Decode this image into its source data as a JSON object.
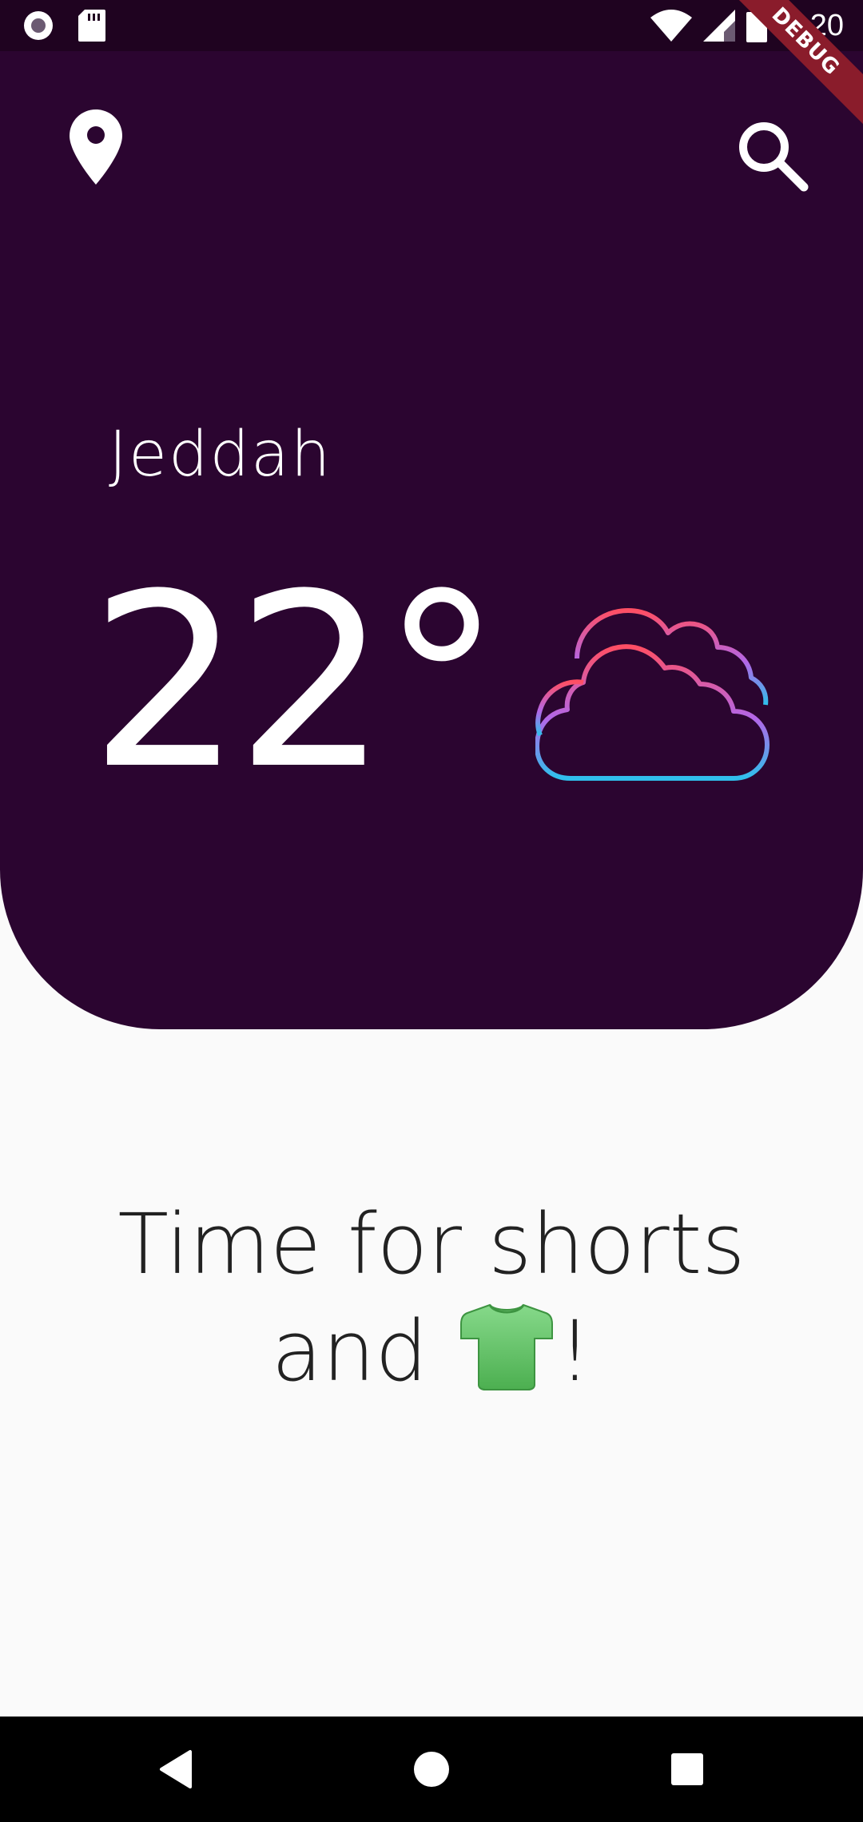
{
  "status_bar": {
    "time": "8:20",
    "left_icons": [
      "record-icon",
      "sd-card-icon"
    ],
    "right_icons": [
      "wifi-icon",
      "signal-icon",
      "battery-icon"
    ]
  },
  "debug_banner": "DEBUG",
  "header": {
    "background": "#2b0530",
    "location_icon": "location-pin-icon",
    "search_icon": "search-icon",
    "city": "Jeddah",
    "temperature": "22°",
    "weather_icon": "cloud-icon",
    "gradient_colors": [
      "#ff4f64",
      "#b267e8",
      "#2fc0ec"
    ]
  },
  "message": {
    "line1": "Time for shorts",
    "line2_prefix": "and ",
    "emoji_icon": "t-shirt-icon",
    "line2_suffix": "!"
  },
  "nav_bar": {
    "buttons": [
      "back",
      "home",
      "recents"
    ]
  }
}
